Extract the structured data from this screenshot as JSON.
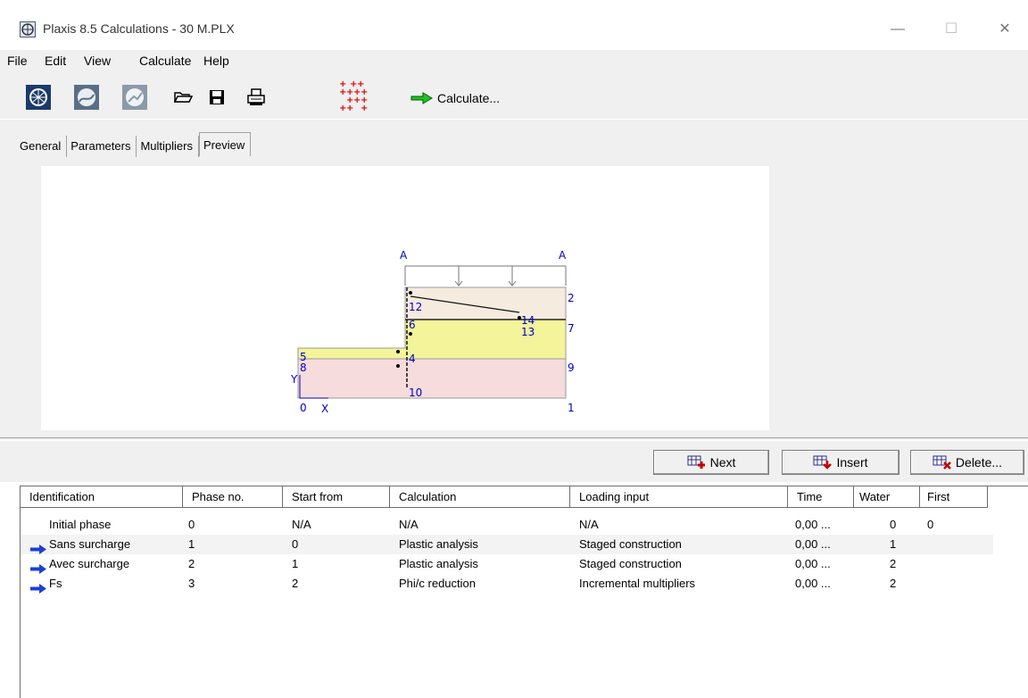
{
  "window": {
    "title": "Plaxis 8.5 Calculations - 30 M.PLX",
    "minimize_glyph": "—",
    "maximize_glyph": "☐",
    "close_glyph": "✕"
  },
  "menu": [
    "File",
    "Edit",
    "View",
    "Calculate",
    "Help"
  ],
  "toolbar": {
    "icons": [
      "input-program-icon",
      "output-program-icon",
      "curves-program-icon",
      "open-folder-icon",
      "save-icon",
      "print-icon",
      "select-points-icon"
    ],
    "calculate_label": "Calculate..."
  },
  "tabs": {
    "general": "General",
    "parameters": "Parameters",
    "multipliers": "Multipliers",
    "preview": "Preview",
    "active": "Preview"
  },
  "preview": {
    "section_labels": [
      "A",
      "A"
    ],
    "axis_x": "X",
    "axis_y": "Y",
    "point_numbers": [
      "0",
      "1",
      "2",
      "7",
      "9",
      "8",
      "5",
      "6",
      "4",
      "10",
      "14",
      "13",
      "12"
    ]
  },
  "buttons": {
    "next": "Next",
    "insert": "Insert",
    "delete": "Delete..."
  },
  "table": {
    "headers": [
      "Identification",
      "Phase no.",
      "Start from",
      "Calculation",
      "Loading input",
      "Time",
      "Water",
      "First"
    ],
    "rows": [
      {
        "id": "Initial phase",
        "phase": "0",
        "start": "N/A",
        "calc": "N/A",
        "loading": "N/A",
        "time": "0,00 ...",
        "water": "0",
        "first": "0",
        "arrow": false
      },
      {
        "id": "Sans surcharge",
        "phase": "1",
        "start": "0",
        "calc": "Plastic analysis",
        "loading": "Staged construction",
        "time": "0,00 ...",
        "water": "1",
        "first": "",
        "arrow": true
      },
      {
        "id": "Avec surcharge",
        "phase": "2",
        "start": "1",
        "calc": "Plastic analysis",
        "loading": "Staged construction",
        "time": "0,00 ...",
        "water": "2",
        "first": "",
        "arrow": true
      },
      {
        "id": "Fs",
        "phase": "3",
        "start": "2",
        "calc": "Phi/c reduction",
        "loading": "Incremental multipliers",
        "time": "0,00 ...",
        "water": "2",
        "first": "",
        "arrow": true
      }
    ]
  },
  "colors": {
    "soil_top": "#f6ebdf",
    "soil_middle": "#f4f49a",
    "soil_bottom": "#f6dcdc",
    "label_blue": "#0000cc",
    "arrow_blue": "#1a3fd6"
  }
}
